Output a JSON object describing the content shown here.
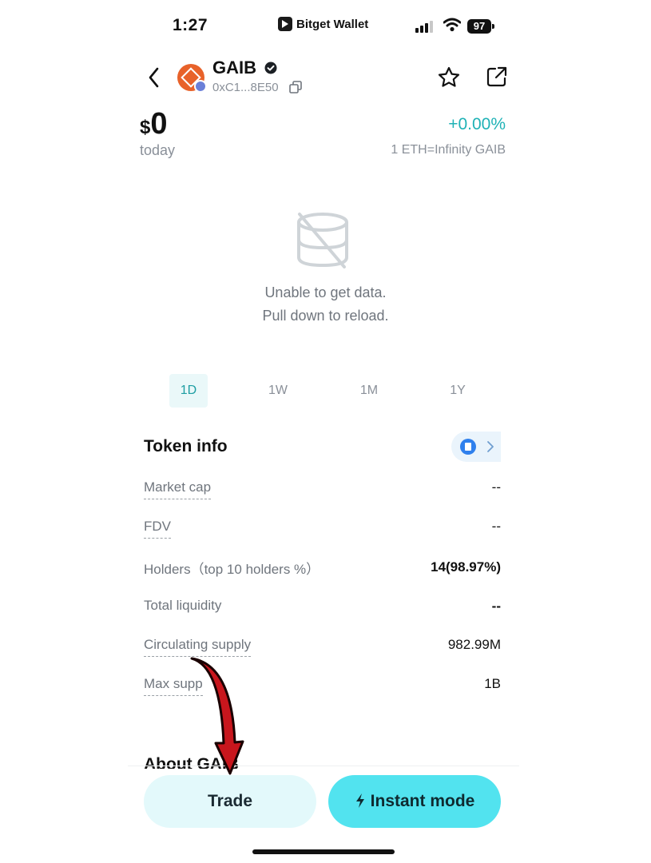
{
  "status_bar": {
    "time": "1:27",
    "app_name": "Bitget Wallet",
    "battery": "97"
  },
  "header": {
    "token_name": "GAIB",
    "token_address": "0xC1...8E50",
    "icons": [
      "back-icon",
      "verified-icon",
      "copy-icon",
      "star-icon",
      "share-icon"
    ]
  },
  "price": {
    "currency": "$",
    "value": "0",
    "period": "today",
    "change": "+0.00%",
    "rate": "1 ETH=Infinity GAIB"
  },
  "chart": {
    "empty_line1": "Unable to get data.",
    "empty_line2": "Pull down to reload.",
    "ranges": [
      "1D",
      "1W",
      "1M",
      "1Y"
    ],
    "active_range": "1D"
  },
  "token_info": {
    "title": "Token info",
    "rows": [
      {
        "label": "Market cap",
        "value": "--"
      },
      {
        "label": "FDV",
        "value": "--"
      },
      {
        "label": "Holders（top 10 holders %）",
        "value": "14(98.97%)"
      },
      {
        "label": "Total liquidity",
        "value": "--"
      },
      {
        "label": "Circulating supply",
        "value": "982.99M"
      },
      {
        "label": "Max supp",
        "value": "1B"
      }
    ]
  },
  "about": {
    "title": "About GAIB"
  },
  "actions": {
    "trade": "Trade",
    "instant": "Instant mode"
  },
  "colors": {
    "accent": "#1fb2b6",
    "instant_bg": "#52e3ef",
    "trade_bg": "#e3f9fb",
    "annotation_arrow": "#c8161d"
  }
}
